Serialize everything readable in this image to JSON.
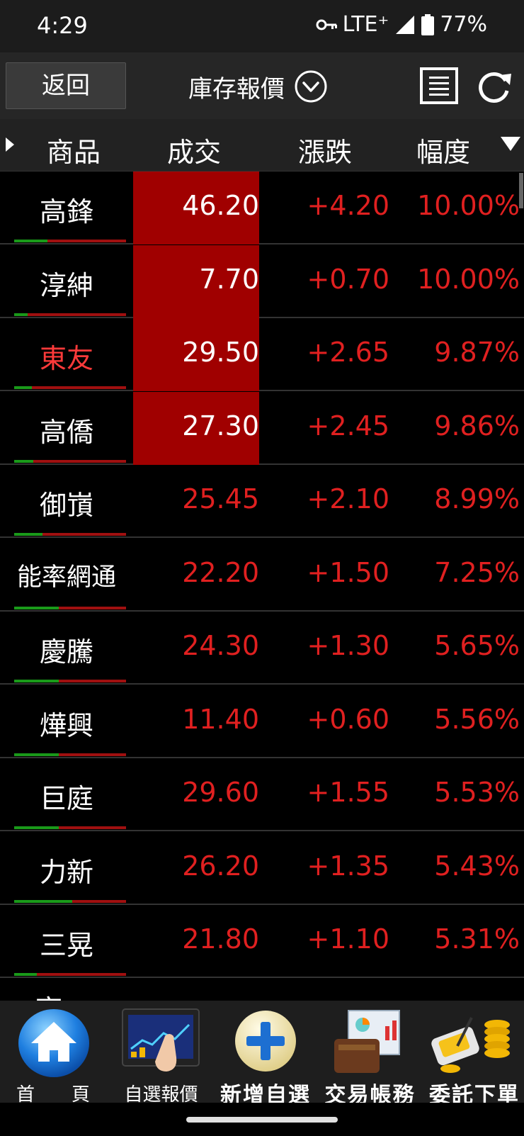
{
  "status": {
    "time": "4:29",
    "network": "LTE⁺",
    "battery": "77%"
  },
  "toolbar": {
    "back_label": "返回",
    "title": "庫存報價"
  },
  "columns": {
    "name": "商品",
    "price": "成交",
    "change": "漲跌",
    "percent": "幅度"
  },
  "colors": {
    "up": "#e02020",
    "limit_up_bg": "#a00000",
    "green": "#1a9a1a"
  },
  "rows": [
    {
      "name": "高鋒",
      "price": "46.20",
      "change": "+4.20",
      "percent": "10.00%",
      "limit_up": true,
      "name_red": false,
      "buy_ratio": 0.3
    },
    {
      "name": "淳紳",
      "price": "7.70",
      "change": "+0.70",
      "percent": "10.00%",
      "limit_up": true,
      "name_red": false,
      "buy_ratio": 0.12
    },
    {
      "name": "東友",
      "price": "29.50",
      "change": "+2.65",
      "percent": "9.87%",
      "limit_up": true,
      "name_red": true,
      "buy_ratio": 0.16
    },
    {
      "name": "高僑",
      "price": "27.30",
      "change": "+2.45",
      "percent": "9.86%",
      "limit_up": true,
      "name_red": false,
      "buy_ratio": 0.17
    },
    {
      "name": "御嵿",
      "price": "25.45",
      "change": "+2.10",
      "percent": "8.99%",
      "limit_up": false,
      "name_red": false,
      "buy_ratio": 0.25
    },
    {
      "name": "能率網通",
      "price": "22.20",
      "change": "+1.50",
      "percent": "7.25%",
      "limit_up": false,
      "name_red": false,
      "buy_ratio": 0.4
    },
    {
      "name": "慶騰",
      "price": "24.30",
      "change": "+1.30",
      "percent": "5.65%",
      "limit_up": false,
      "name_red": false,
      "buy_ratio": 0.4
    },
    {
      "name": "燁興",
      "price": "11.40",
      "change": "+0.60",
      "percent": "5.56%",
      "limit_up": false,
      "name_red": false,
      "buy_ratio": 0.4
    },
    {
      "name": "巨庭",
      "price": "29.60",
      "change": "+1.55",
      "percent": "5.53%",
      "limit_up": false,
      "name_red": false,
      "buy_ratio": 0.4
    },
    {
      "name": "力新",
      "price": "26.20",
      "change": "+1.35",
      "percent": "5.43%",
      "limit_up": false,
      "name_red": false,
      "buy_ratio": 0.52
    },
    {
      "name": "三晃",
      "price": "21.80",
      "change": "+1.10",
      "percent": "5.31%",
      "limit_up": false,
      "name_red": false,
      "buy_ratio": 0.2
    }
  ],
  "nav": {
    "home": "首　　頁",
    "watchlist": "自選報價",
    "add_watch": "新增自選",
    "account": "交易帳務",
    "order": "委託下單"
  }
}
